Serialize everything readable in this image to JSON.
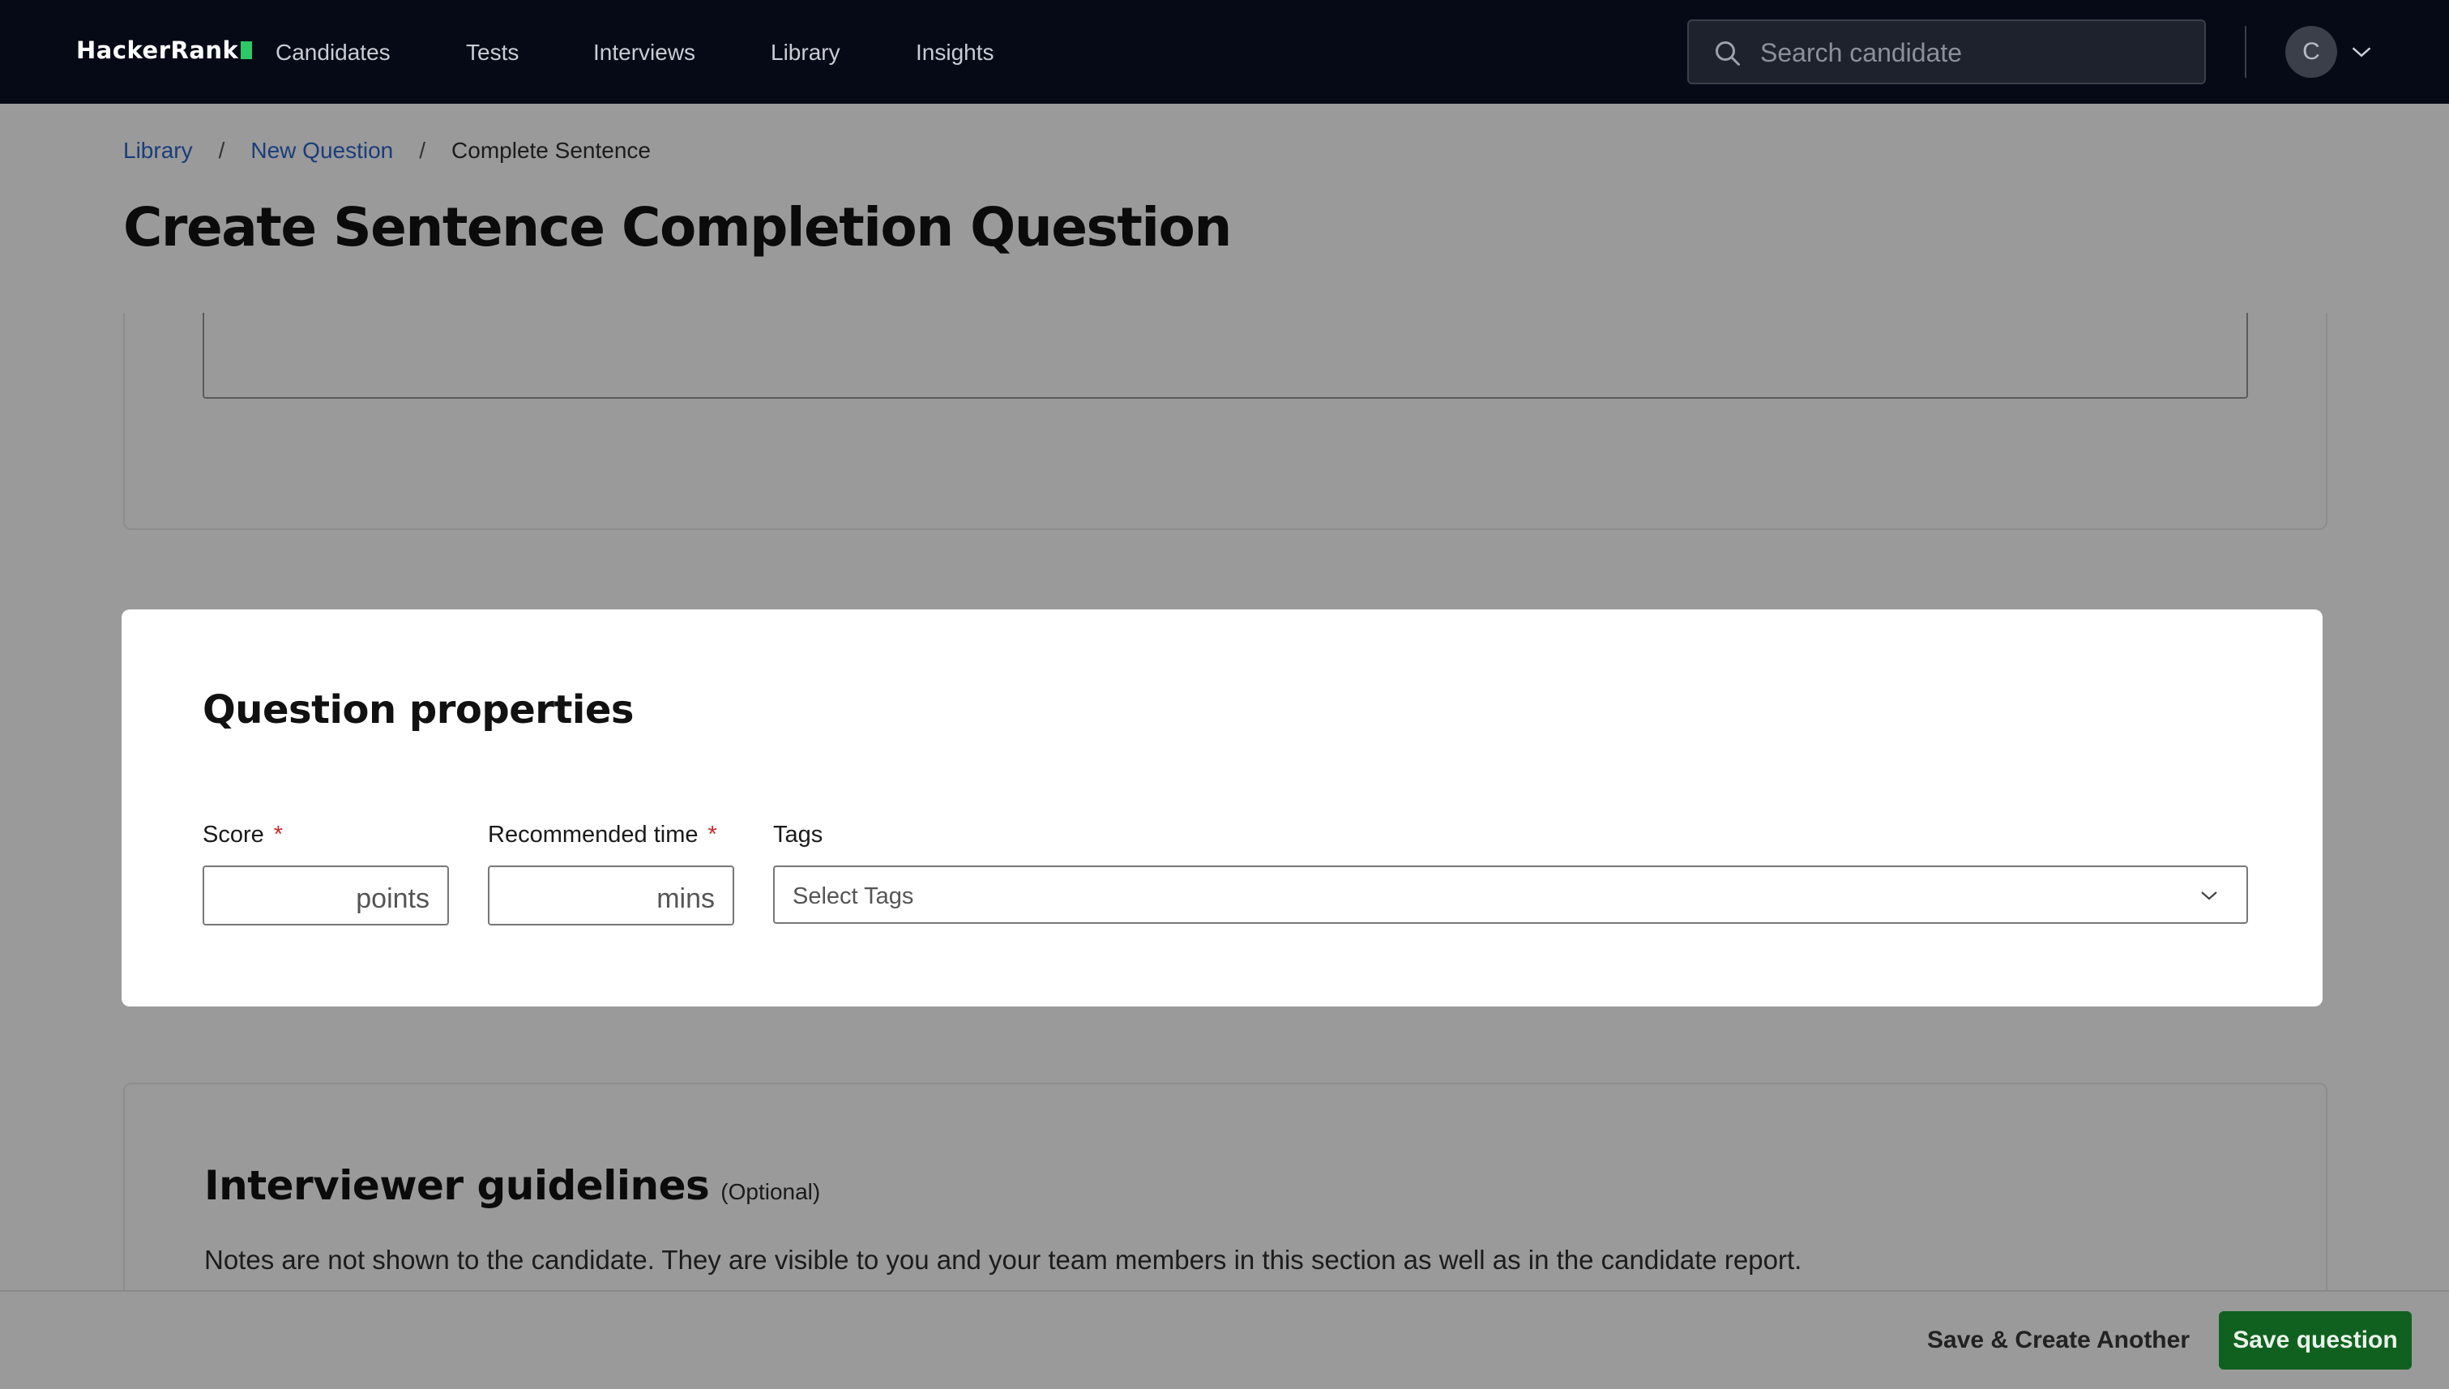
{
  "nav": {
    "logo": "HackerRank",
    "items": [
      "Candidates",
      "Tests",
      "Interviews",
      "Library",
      "Insights"
    ],
    "search_placeholder": "Search candidate",
    "avatar_initial": "C"
  },
  "breadcrumb": {
    "items": [
      "Library",
      "New Question",
      "Complete Sentence"
    ],
    "separator": "/"
  },
  "page": {
    "title": "Create Sentence Completion Question"
  },
  "properties": {
    "title": "Question properties",
    "score_label": "Score",
    "score_suffix": "points",
    "time_label": "Recommended time",
    "time_suffix": "mins",
    "required_mark": "*",
    "tags_label": "Tags",
    "tags_placeholder": "Select Tags"
  },
  "guidelines": {
    "title": "Interviewer guidelines",
    "optional": "(Optional)",
    "description": "Notes are not shown to the candidate. They are visible to you and your team members in this section as well as in the candidate report."
  },
  "footer": {
    "secondary_label": "Save & Create Another",
    "primary_label": "Save question"
  },
  "colors": {
    "nav_bg": "#050a16",
    "primary": "#10611f",
    "link": "#1a3d7a",
    "required": "#c22a2a"
  }
}
